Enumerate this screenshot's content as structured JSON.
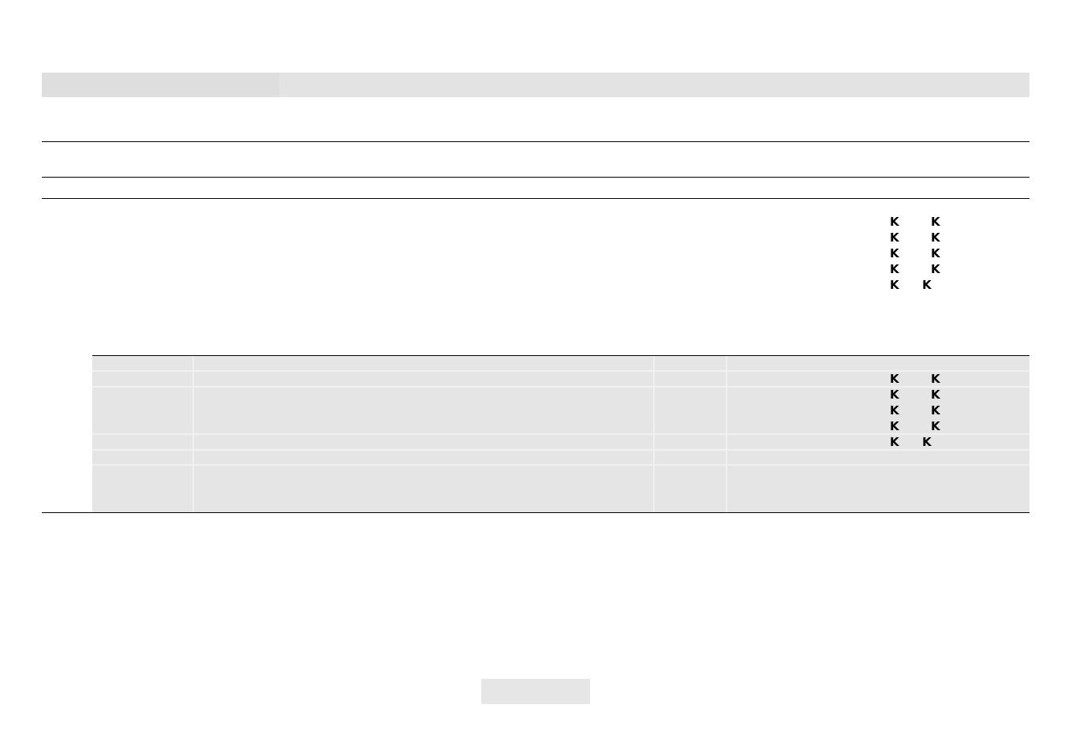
{
  "symbols": {
    "open_mark": "K",
    "close_mark": "K"
  },
  "upper_marks_rows": 5,
  "table_marks_rows": 5
}
